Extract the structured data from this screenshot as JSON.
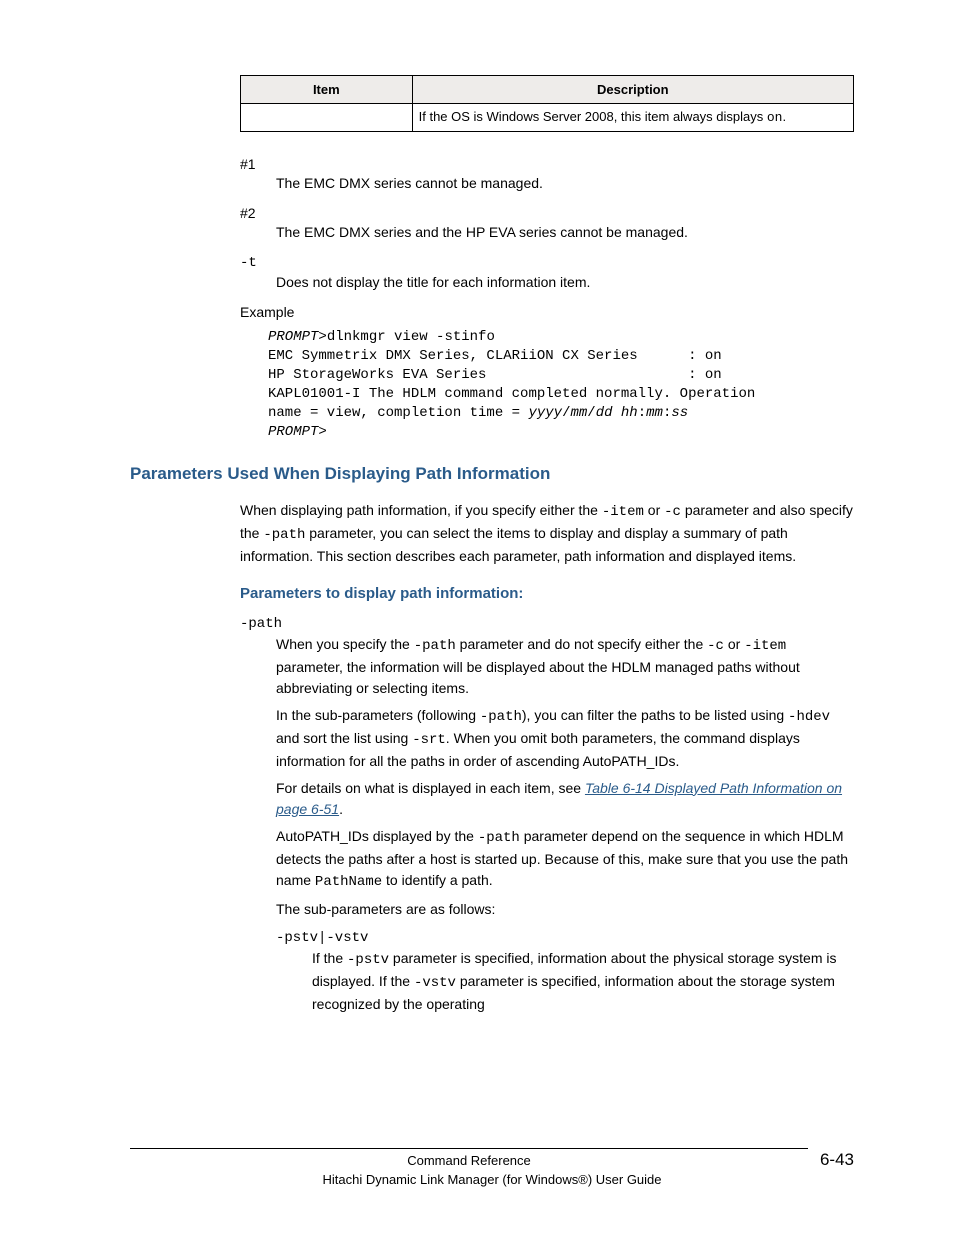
{
  "table": {
    "headers": {
      "item": "Item",
      "description": "Description"
    },
    "row": {
      "item": "",
      "desc_prefix": "If the OS is Windows Server 2008, this item always displays ",
      "desc_code": "on",
      "desc_suffix": "."
    }
  },
  "notes": {
    "n1_label": "#1",
    "n1_text": "The EMC DMX series cannot be managed.",
    "n2_label": "#2",
    "n2_text": "The EMC DMX series and the HP EVA series cannot be managed.",
    "t_label": "-t",
    "t_text": "Does not display the title for each information item.",
    "example_label": "Example"
  },
  "code": {
    "prompt1": "PROMPT",
    "line1_rest": ">dlnkmgr view -stinfo",
    "line2": "EMC Symmetrix DMX Series, CLARiiON CX Series      : on",
    "line3": "HP StorageWorks EVA Series                        : on",
    "line4_a": "KAPL01001-I The HDLM command completed normally. Operation",
    "line5_a": "name = view, completion time = ",
    "ts": "yyyy",
    "sep1": "/",
    "mm": "mm",
    "sep2": "/",
    "dd": "dd",
    "sp": " ",
    "hh": "hh",
    "colon1": ":",
    "mi": "mm",
    "colon2": ":",
    "ss": "ss",
    "prompt2": "PROMPT",
    "gt": ">"
  },
  "section": {
    "heading": "Parameters Used When Displaying Path Information",
    "intro_a": "When displaying path information, if you specify either the ",
    "intro_code1": "-item",
    "intro_b": " or ",
    "intro_code2": "-c",
    "intro_c": " parameter and also specify the ",
    "intro_code3": "-path",
    "intro_d": " parameter, you can select the items to display and display a summary of path information. This section describes each parameter, path information and displayed items."
  },
  "subhead": "Parameters to display path information:",
  "path": {
    "label": "-path",
    "p1a": "When you specify the ",
    "p1c1": "-path",
    "p1b": " parameter and do not specify either the ",
    "p1c2": "-c",
    "p1c": " or ",
    "p1c3": "-item",
    "p1d": " parameter, the information will be displayed about the HDLM managed paths without abbreviating or selecting items.",
    "p2a": "In the sub-parameters (following ",
    "p2c1": "-path",
    "p2b": "), you can filter the paths to be listed using ",
    "p2c2": "-hdev",
    "p2c": " and sort the list using ",
    "p2c3": "-srt",
    "p2d": ". When you omit both parameters, the command displays information for all the paths in order of ascending AutoPATH_IDs.",
    "p3a": "For details on what is displayed in each item, see ",
    "p3link": "Table 6-14 Displayed Path Information on page 6-51",
    "p3b": ".",
    "p4a": "AutoPATH_IDs displayed by the ",
    "p4c1": "-path",
    "p4b": " parameter depend on the sequence in which HDLM detects the paths after a host is started up. Because of this, make sure that you use the path name ",
    "p4c2": "PathName",
    "p4c": " to identify a path.",
    "p5": "The sub-parameters are as follows:"
  },
  "pstv": {
    "label": "-pstv|-vstv",
    "a": "If the ",
    "c1": "-pstv",
    "b": " parameter is specified, information about the physical storage system is displayed. If the ",
    "c2": "-vstv",
    "c": " parameter is specified, information about the storage system recognized by the operating"
  },
  "footer": {
    "chapter": "Command Reference",
    "book": "Hitachi Dynamic Link Manager (for Windows®) User Guide",
    "page": "6-43"
  }
}
